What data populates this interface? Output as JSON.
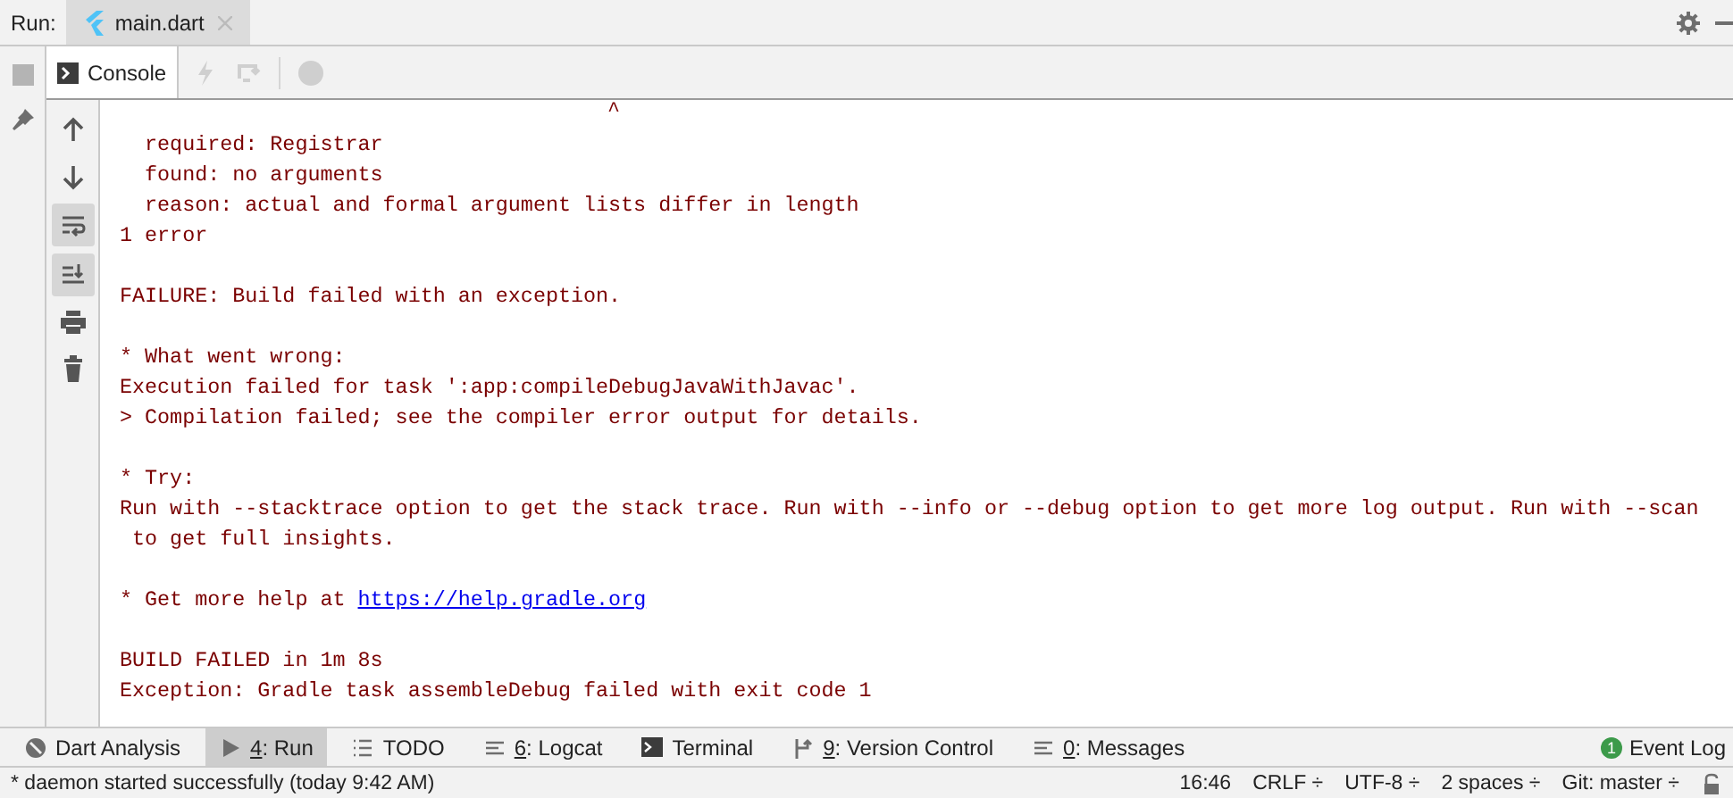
{
  "run_bar": {
    "label": "Run:",
    "tabs": [
      {
        "label": "main.dart",
        "selected": true
      }
    ]
  },
  "console_tab": {
    "label": "Console",
    "selected": true
  },
  "console": {
    "caret": "^",
    "lines": [
      {
        "kind": "text",
        "text": "  required: Registrar"
      },
      {
        "kind": "text",
        "text": "  found: no arguments"
      },
      {
        "kind": "text",
        "text": "  reason: actual and formal argument lists differ in length"
      },
      {
        "kind": "text",
        "text": "1 error"
      },
      {
        "kind": "blank"
      },
      {
        "kind": "text",
        "text": "FAILURE: Build failed with an exception."
      },
      {
        "kind": "blank"
      },
      {
        "kind": "text",
        "text": "* What went wrong:"
      },
      {
        "kind": "text",
        "text": "Execution failed for task ':app:compileDebugJavaWithJavac'."
      },
      {
        "kind": "text",
        "text": "> Compilation failed; see the compiler error output for details."
      },
      {
        "kind": "blank"
      },
      {
        "kind": "text",
        "text": "* Try:"
      },
      {
        "kind": "text",
        "text": "Run with --stacktrace option to get the stack trace. Run with --info or --debug option to get more log output. Run with --scan"
      },
      {
        "kind": "text",
        "text": " to get full insights."
      },
      {
        "kind": "blank"
      },
      {
        "kind": "link",
        "text": "* Get more help at ",
        "link": "https://help.gradle.org"
      },
      {
        "kind": "blank"
      },
      {
        "kind": "text",
        "text": "BUILD FAILED in 1m 8s"
      },
      {
        "kind": "text",
        "text": "Exception: Gradle task assembleDebug failed with exit code 1"
      }
    ]
  },
  "tool_windows": [
    {
      "kind": "analysis",
      "label": "Dart Analysis",
      "selected": false
    },
    {
      "kind": "run",
      "label": "4: Run",
      "selected": true
    },
    {
      "kind": "list",
      "label": "TODO",
      "selected": false
    },
    {
      "kind": "lines",
      "label": "6: Logcat",
      "selected": false
    },
    {
      "kind": "terminal",
      "label": "Terminal",
      "selected": false
    },
    {
      "kind": "vcs",
      "label": "9: Version Control",
      "selected": false
    },
    {
      "kind": "lines",
      "label": "0: Messages",
      "selected": false
    }
  ],
  "event_log": {
    "label": "Event Log",
    "badge": "1"
  },
  "status_bar": {
    "message": "* daemon started successfully (today 9:42 AM)",
    "items": [
      "16:46",
      "CRLF ÷",
      "UTF-8 ÷",
      "2 spaces ÷",
      "Git: master ÷"
    ]
  }
}
